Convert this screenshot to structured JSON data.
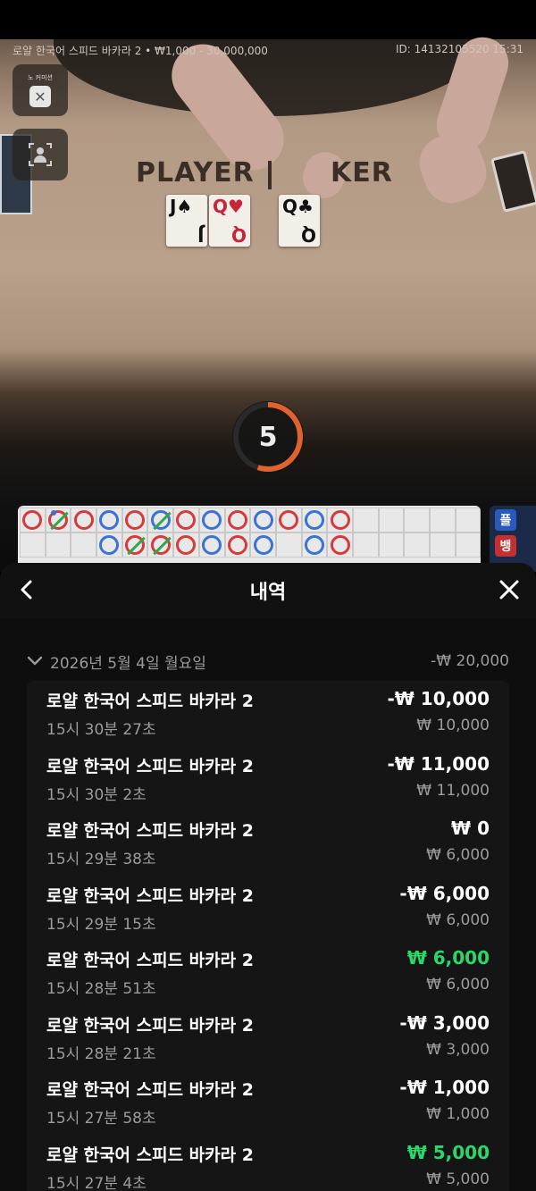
{
  "video": {
    "table_info": "로얄 한국어 스피드 바카라 2 • ₩1,000 - 30,000,000",
    "game_id": "ID: 14132105520 15:31",
    "no_commission_label": "노 커미션",
    "felt_player": "PLAYER",
    "felt_banker": "KER",
    "cards": [
      {
        "rank": "J",
        "suit": "♠",
        "color": "black"
      },
      {
        "rank": "Q",
        "suit": "♥",
        "color": "red"
      },
      {
        "rank": "Q",
        "suit": "♣",
        "color": "black"
      }
    ],
    "countdown": "5",
    "countdown_progress": 0.55
  },
  "roadmap": {
    "rows": [
      [
        "b",
        "b dot slash",
        "b",
        "p",
        "b",
        "p slash",
        "b",
        "p",
        "b",
        "p",
        "b",
        "p",
        "b",
        "",
        "",
        "",
        "",
        ""
      ],
      [
        "",
        "",
        "",
        "p",
        "b slash",
        "b slash",
        "b",
        "p",
        "b",
        "p",
        "",
        "p",
        "b",
        "",
        "",
        "",
        "",
        ""
      ]
    ],
    "side_labels": [
      "플",
      "뱅"
    ]
  },
  "history": {
    "title": "내역",
    "date": "2026년 5월 4일 월요일",
    "date_total": "-₩ 20,000",
    "items": [
      {
        "name": "로얄 한국어 스피드 바카라 2",
        "time": "15시 30분 27초",
        "result": "-₩ 10,000",
        "stake": "₩ 10,000",
        "win": false
      },
      {
        "name": "로얄 한국어 스피드 바카라 2",
        "time": "15시 30분 2초",
        "result": "-₩ 11,000",
        "stake": "₩ 11,000",
        "win": false
      },
      {
        "name": "로얄 한국어 스피드 바카라 2",
        "time": "15시 29분 38초",
        "result": "₩ 0",
        "stake": "₩ 6,000",
        "win": false
      },
      {
        "name": "로얄 한국어 스피드 바카라 2",
        "time": "15시 29분 15초",
        "result": "-₩ 6,000",
        "stake": "₩ 6,000",
        "win": false
      },
      {
        "name": "로얄 한국어 스피드 바카라 2",
        "time": "15시 28분 51초",
        "result": "₩ 6,000",
        "stake": "₩ 6,000",
        "win": true
      },
      {
        "name": "로얄 한국어 스피드 바카라 2",
        "time": "15시 28분 21초",
        "result": "-₩ 3,000",
        "stake": "₩ 3,000",
        "win": false
      },
      {
        "name": "로얄 한국어 스피드 바카라 2",
        "time": "15시 27분 58초",
        "result": "-₩ 1,000",
        "stake": "₩ 1,000",
        "win": false
      },
      {
        "name": "로얄 한국어 스피드 바카라 2",
        "time": "15시 27분 4초",
        "result": "₩ 5,000",
        "stake": "₩ 5,000",
        "win": true
      }
    ]
  }
}
